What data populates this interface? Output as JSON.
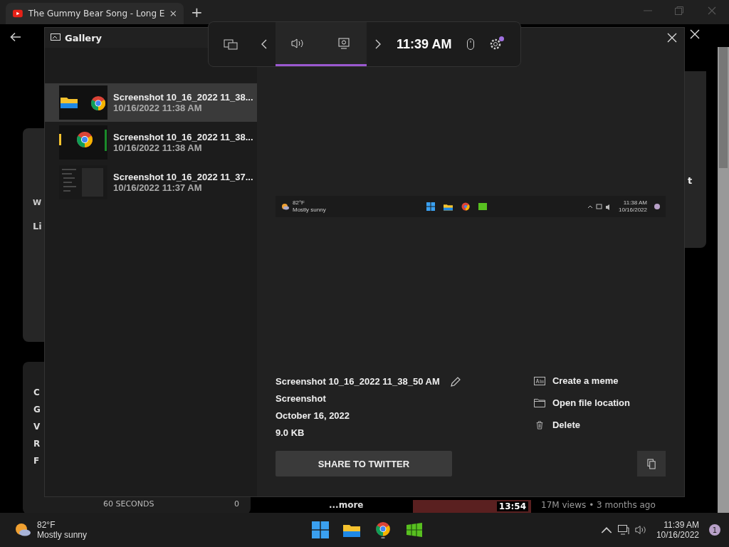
{
  "browser": {
    "tab_title": "The Gummy Bear Song - Long E",
    "new_tab": "+"
  },
  "background": {
    "widget_fragments": [
      "W",
      "Li"
    ],
    "performance_fragments": [
      "C",
      "G",
      "V",
      "R",
      "F"
    ],
    "footer_label": "60 SECONDS",
    "footer_value": "0",
    "more_link": "...more",
    "video_duration": "13:54",
    "video_meta": "17M views • 3 months ago",
    "right_fragment": "t"
  },
  "gallery": {
    "title": "Gallery",
    "items": [
      {
        "name": "Screenshot 10_16_2022 11_38...",
        "date": "10/16/2022 11:38 AM",
        "kind": "apps",
        "selected": true
      },
      {
        "name": "Screenshot 10_16_2022 11_38...",
        "date": "10/16/2022 11:38 AM",
        "kind": "apps-cut",
        "selected": false
      },
      {
        "name": "Screenshot 10_16_2022 11_37...",
        "date": "10/16/2022 11:37 AM",
        "kind": "list",
        "selected": false
      }
    ],
    "preview": {
      "temperature": "82°F",
      "weather": "Mostly sunny",
      "time": "11:38 AM",
      "date": "10/16/2022"
    },
    "details": {
      "file_name": "Screenshot 10_16_2022 11_38_50 AM",
      "type": "Screenshot",
      "date": "October 16, 2022",
      "size": "9.0 KB"
    },
    "actions": [
      {
        "kind": "meme",
        "label": "Create a meme"
      },
      {
        "kind": "folder",
        "label": "Open file location"
      },
      {
        "kind": "delete",
        "label": "Delete"
      }
    ],
    "share_button": "SHARE TO TWITTER"
  },
  "game_bar": {
    "time": "11:39 AM",
    "settings_badge": true,
    "widgets": [
      {
        "kind": "audio",
        "selected": true
      },
      {
        "kind": "capture",
        "selected": true
      }
    ]
  },
  "taskbar": {
    "temperature": "82°F",
    "weather": "Mostly sunny",
    "time": "11:39 AM",
    "date": "10/16/2022",
    "notifications": "1"
  }
}
